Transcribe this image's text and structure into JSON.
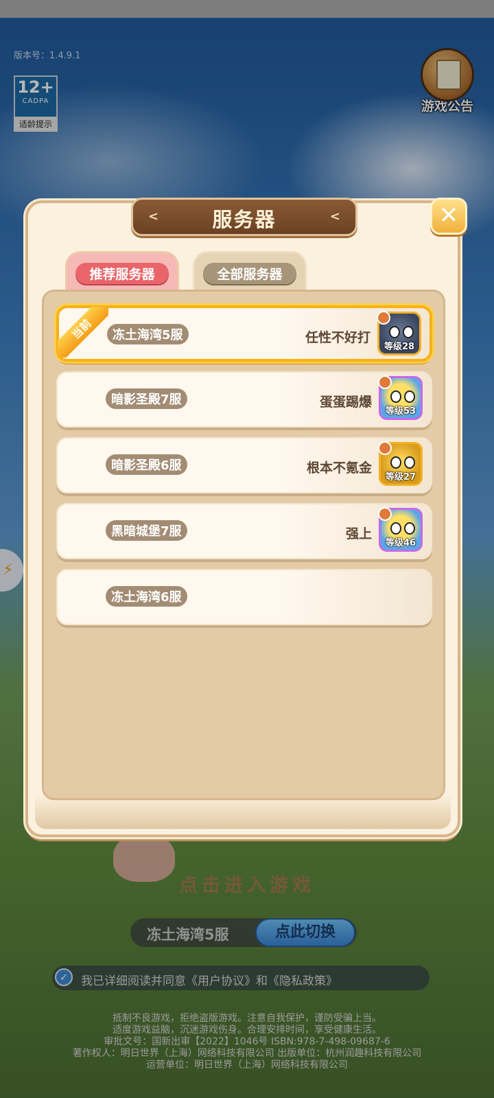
{
  "app": {
    "version_label": "版本号：1.4.9.1",
    "age_rating": {
      "number": "12+",
      "org": "CADPA",
      "tip": "适龄提示"
    },
    "notice_label": "游戏公告"
  },
  "dialog": {
    "title": "服务器",
    "close_glyph": "✕",
    "tabs": [
      {
        "label": "推荐服务器",
        "active": true
      },
      {
        "label": "全部服务器",
        "active": false
      }
    ],
    "current_tag": "当前",
    "servers": [
      {
        "name": "冻土海湾5服",
        "player": "任性不好打",
        "level": "等级28",
        "current": true,
        "avatar": "dark"
      },
      {
        "name": "暗影圣殿7服",
        "player": "蛋蛋踢爆",
        "level": "等级53",
        "current": false,
        "avatar": "blue"
      },
      {
        "name": "暗影圣殿6服",
        "player": "根本不氪金",
        "level": "等级27",
        "current": false,
        "avatar": "yellow"
      },
      {
        "name": "黑暗城堡7服",
        "player": "强上",
        "level": "等级46",
        "current": false,
        "avatar": "blue"
      },
      {
        "name": "冻土海湾6服",
        "player": "",
        "level": "",
        "current": false,
        "avatar": "none"
      }
    ]
  },
  "footer": {
    "enter_game": "点击进入游戏",
    "selected_server": "冻土海湾5服",
    "switch_label": "点此切换",
    "agreement": "我已详细阅读并同意《用户协议》和《隐私政策》",
    "legal_lines": [
      "抵制不良游戏，拒绝盗版游戏。注意自我保护，谨防受骗上当。",
      "适度游戏益脑，沉迷游戏伤身。合理安排时间，享受健康生活。",
      "审批文号：国新出审【2022】1046号        ISBN:978-7-498-09687-6",
      "著作权人：明日世界（上海）网络科技有限公司        出版单位：杭州润趣科技有限公司",
      "运营单位：明日世界（上海）网络科技有限公司"
    ]
  },
  "colors": {
    "current_border": "#f7b118",
    "tab_active": "#e9656a",
    "banner": "#6b4123"
  }
}
